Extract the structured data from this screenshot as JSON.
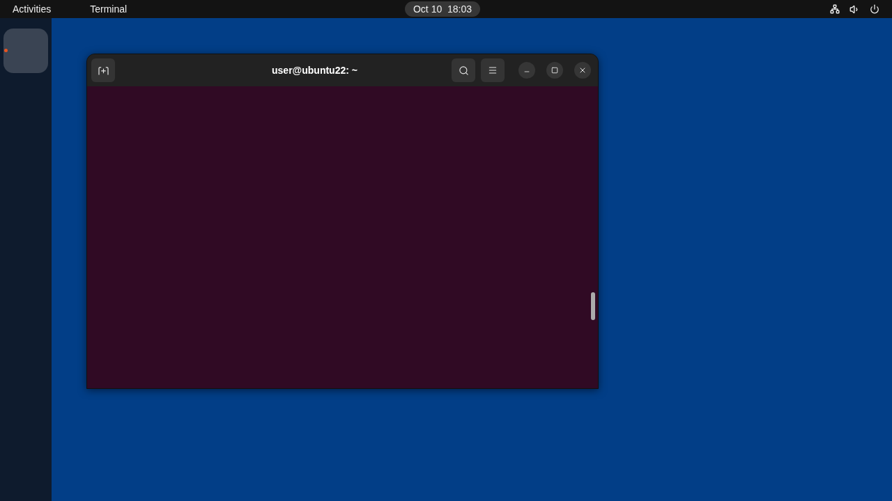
{
  "top_bar": {
    "activities": "Activities",
    "app_menu": "Terminal",
    "clock": "Oct 10  18:03"
  },
  "dock_items": [
    {
      "running": true,
      "focused": true
    }
  ],
  "window": {
    "title": "user@ubuntu22: ~"
  }
}
